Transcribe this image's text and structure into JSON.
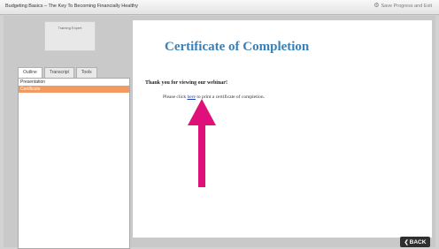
{
  "window": {
    "title": "Budgeting Basics – The Key To Becoming Financially Healthy",
    "save_exit_label": "Save Progress and Exit",
    "save_exit_icon": "gear-icon"
  },
  "sidebar": {
    "logo_text": "Training Expert",
    "tabs": [
      {
        "label": "Outline"
      },
      {
        "label": "Transcript"
      },
      {
        "label": "Tools"
      }
    ],
    "active_tab": "Outline",
    "items": [
      {
        "label": "Presentation"
      },
      {
        "label": "Certificate"
      }
    ],
    "selected_item": "Certificate",
    "selected_color": "#f39a63"
  },
  "content": {
    "heading": "Certificate of Completion",
    "heading_color": "#3a7fb5",
    "thanks": "Thank you for viewing our webinar!",
    "instruction_before": "Please click ",
    "link_text": "here",
    "instruction_after": " to print a certificate of completion."
  },
  "annotation": {
    "arrow_icon": "arrow-up-icon",
    "arrow_color": "#e0107a"
  },
  "footer": {
    "back_label": "BACK",
    "back_icon": "chevron-left-icon"
  }
}
